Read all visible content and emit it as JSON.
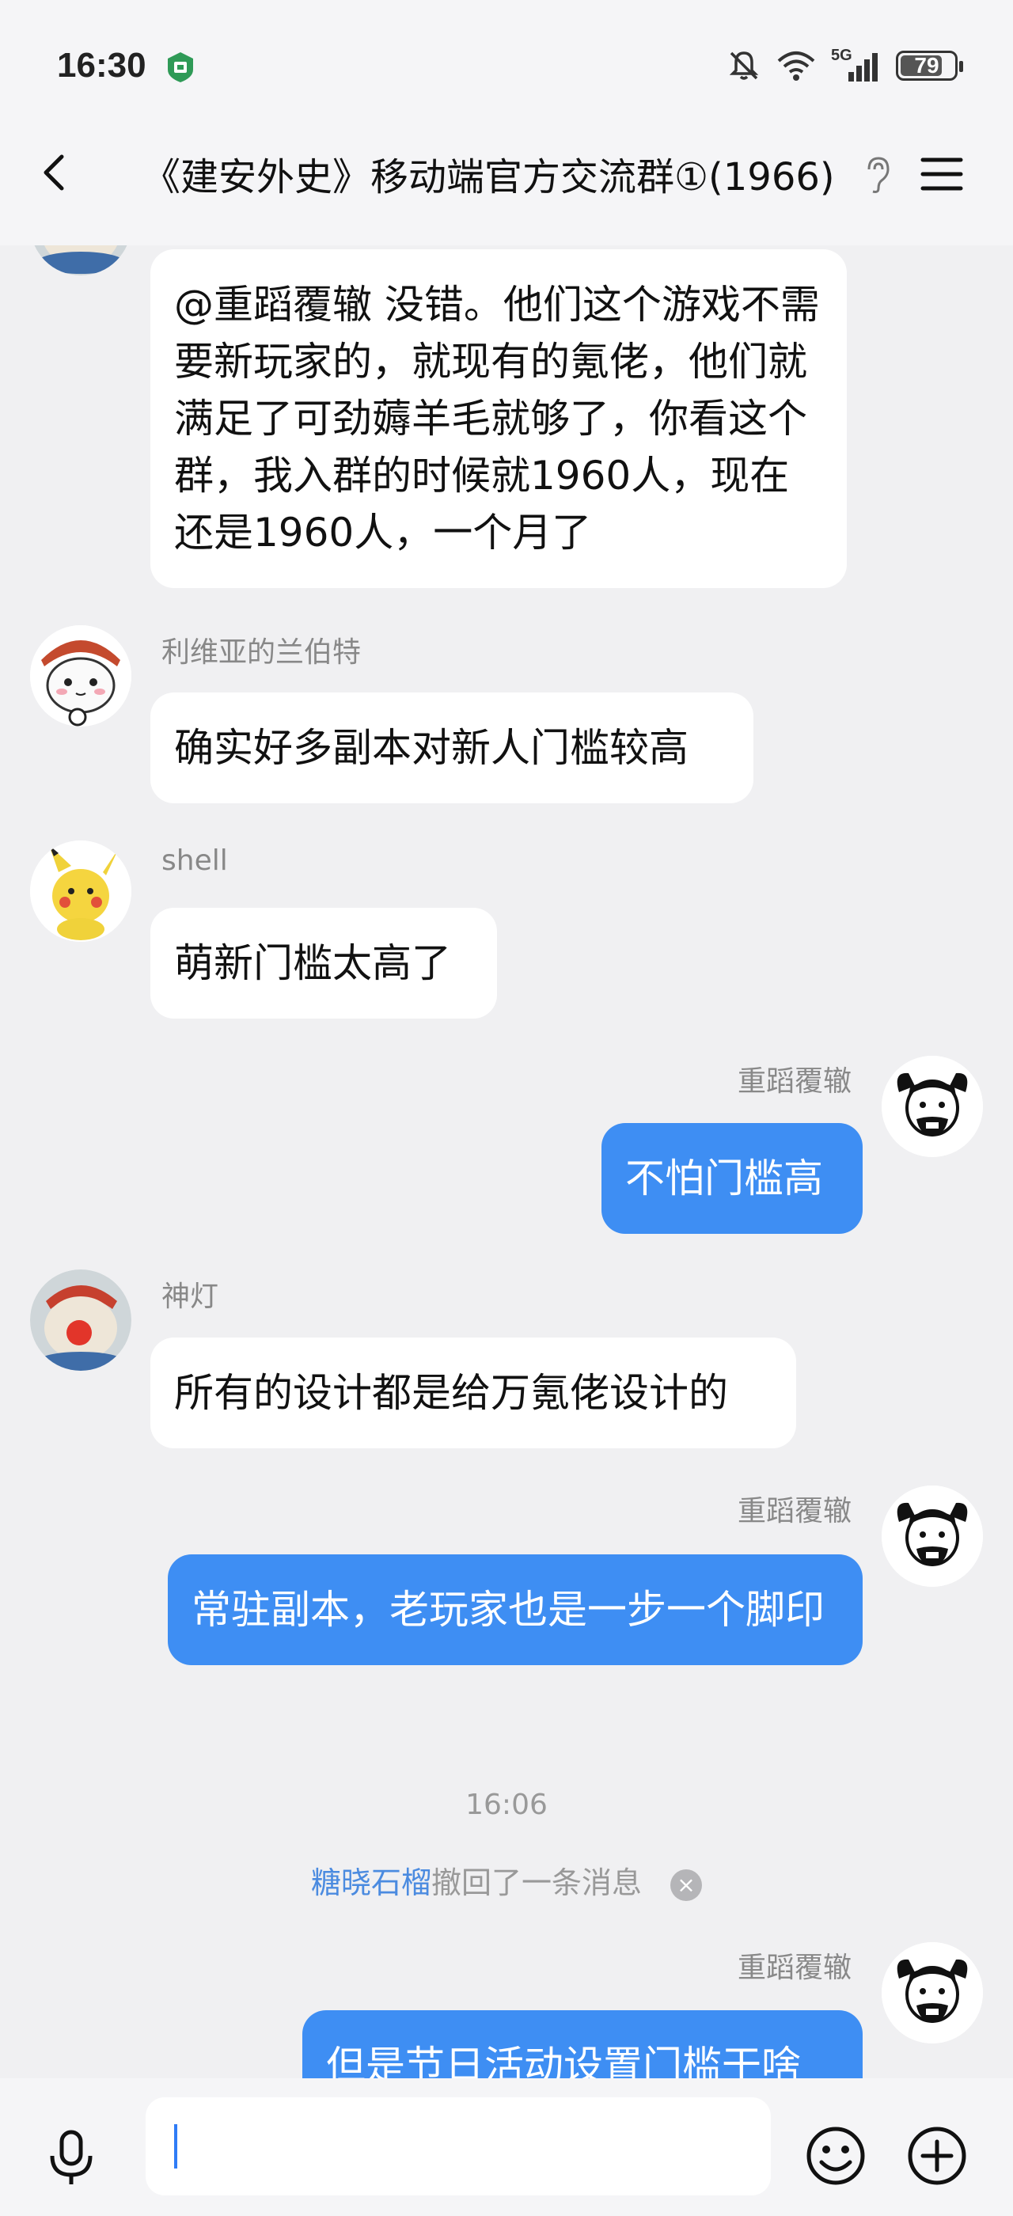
{
  "status_bar": {
    "time": "16:30",
    "network": "5G",
    "battery": "79",
    "battery_level": 0.79
  },
  "header": {
    "title": "《建安外史》移动端官方交流群①(1966)",
    "back_icon": "chevron-left-icon",
    "listen_icon": "ear-icon",
    "menu_icon": "menu-icon"
  },
  "messages": [
    {
      "direction": "in",
      "sender": "",
      "text": "@重蹈覆辙 没错。他们这个游戏不需要新玩家的，就现有的氪佬，他们就满足了可劲薅羊毛就够了，你看这个群，我入群的时候就1960人，现在还是1960人，一个月了"
    },
    {
      "direction": "in",
      "sender": "利维亚的兰伯特",
      "text": "确实好多副本对新人门槛较高"
    },
    {
      "direction": "in",
      "sender": "shell",
      "text": "萌新门槛太高了"
    },
    {
      "direction": "out",
      "sender": "重蹈覆辙",
      "text": "不怕门槛高"
    },
    {
      "direction": "in",
      "sender": "神灯",
      "text": "所有的设计都是给万氪佬设计的"
    },
    {
      "direction": "out",
      "sender": "重蹈覆辙",
      "text": "常驻副本，老玩家也是一步一个脚印"
    },
    {
      "direction": "out",
      "sender": "重蹈覆辙",
      "text": "但是节日活动设置门槛干啥"
    }
  ],
  "timestamp": "16:06",
  "recall_notice": {
    "name": "糖晓石榴",
    "text": "撤回了一条消息",
    "dismiss": "×"
  },
  "input_bar": {
    "value": "",
    "mic_icon": "microphone-icon",
    "emoji_icon": "emoji-icon",
    "plus_icon": "plus-icon"
  },
  "colors": {
    "outgoing_bubble": "#3e8ef3",
    "incoming_bubble": "#ffffff",
    "background": "#f0f0f2",
    "recall_name": "#4b8be0"
  }
}
